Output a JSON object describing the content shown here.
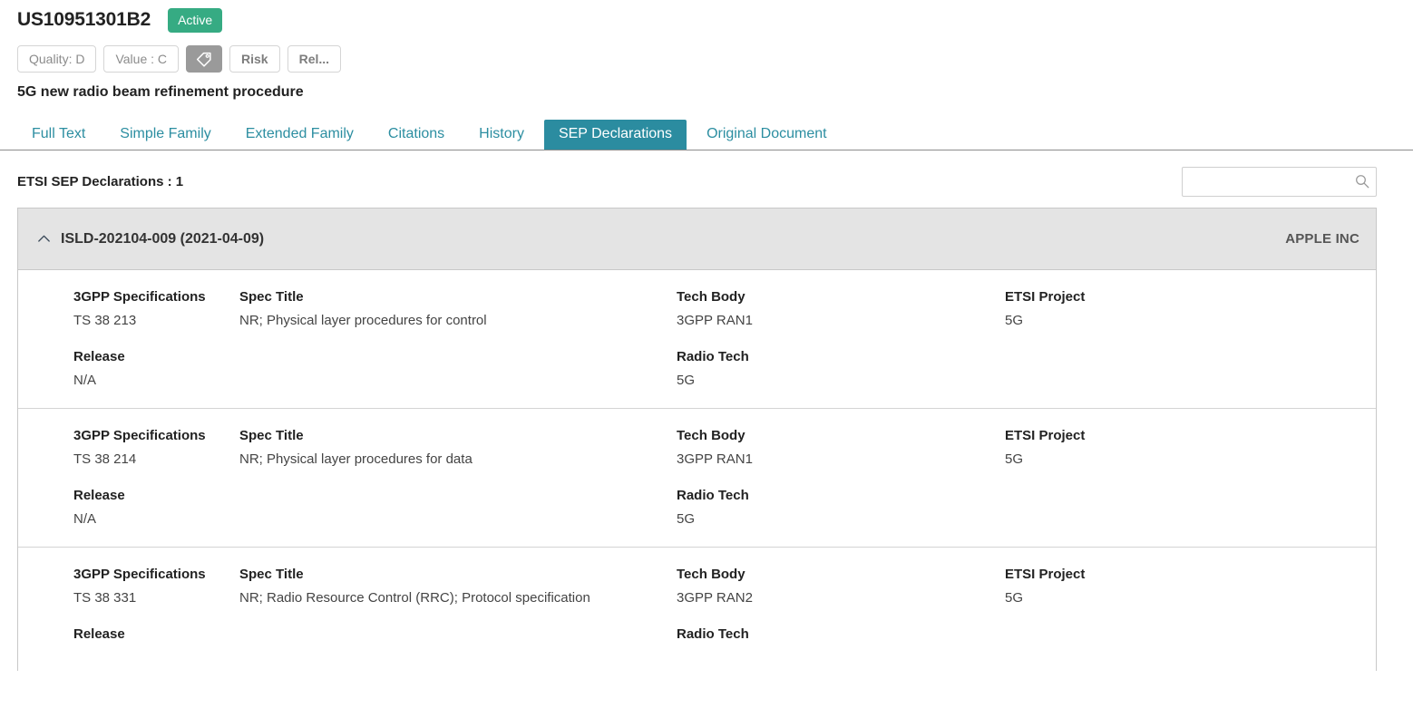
{
  "header": {
    "doc_id": "US10951301B2",
    "status": "Active",
    "chips": [
      {
        "name": "quality-chip",
        "label": "Quality: D",
        "type": "text"
      },
      {
        "name": "value-chip",
        "label": "Value : C",
        "type": "text"
      },
      {
        "name": "tag-chip",
        "label": "",
        "type": "icon",
        "icon": "tag-icon"
      },
      {
        "name": "risk-chip",
        "label": "Risk",
        "type": "text-strong"
      },
      {
        "name": "relevance-chip",
        "label": "Rel...",
        "type": "text-strong"
      }
    ],
    "doc_title": "5G new radio beam refinement procedure",
    "colors": {
      "status_green": "#36ab83",
      "accent_teal": "#2b8ca0",
      "tag_gray": "#9a9a9a"
    }
  },
  "tabs": [
    {
      "label": "Full Text",
      "active": false
    },
    {
      "label": "Simple Family",
      "active": false
    },
    {
      "label": "Extended Family",
      "active": false
    },
    {
      "label": "Citations",
      "active": false
    },
    {
      "label": "History",
      "active": false
    },
    {
      "label": "SEP Declarations",
      "active": true
    },
    {
      "label": "Original Document",
      "active": false
    }
  ],
  "sep_section": {
    "heading": "ETSI SEP Declarations : 1",
    "search": {
      "value": "",
      "placeholder": "",
      "icon": "search-icon"
    }
  },
  "declaration": {
    "id": "ISLD-202104-009 (2021-04-09)",
    "owner": "APPLE INC",
    "expanded": true,
    "collapse_icon": "chevron-up-icon",
    "labels": {
      "spec": "3GPP Specifications",
      "title": "Spec Title",
      "body": "Tech Body",
      "project": "ETSI Project",
      "release": "Release",
      "radio": "Radio Tech"
    },
    "rows": [
      {
        "spec": "TS 38 213",
        "title": "NR; Physical layer procedures for control",
        "body": "3GPP RAN1",
        "project": "5G",
        "release": "N/A",
        "radio": "5G"
      },
      {
        "spec": "TS 38 214",
        "title": "NR; Physical layer procedures for data",
        "body": "3GPP RAN1",
        "project": "5G",
        "release": "N/A",
        "radio": "5G"
      },
      {
        "spec": "TS 38 331",
        "title": "NR; Radio Resource Control (RRC); Protocol specification",
        "body": "3GPP RAN2",
        "project": "5G",
        "release": "",
        "radio": ""
      }
    ]
  }
}
